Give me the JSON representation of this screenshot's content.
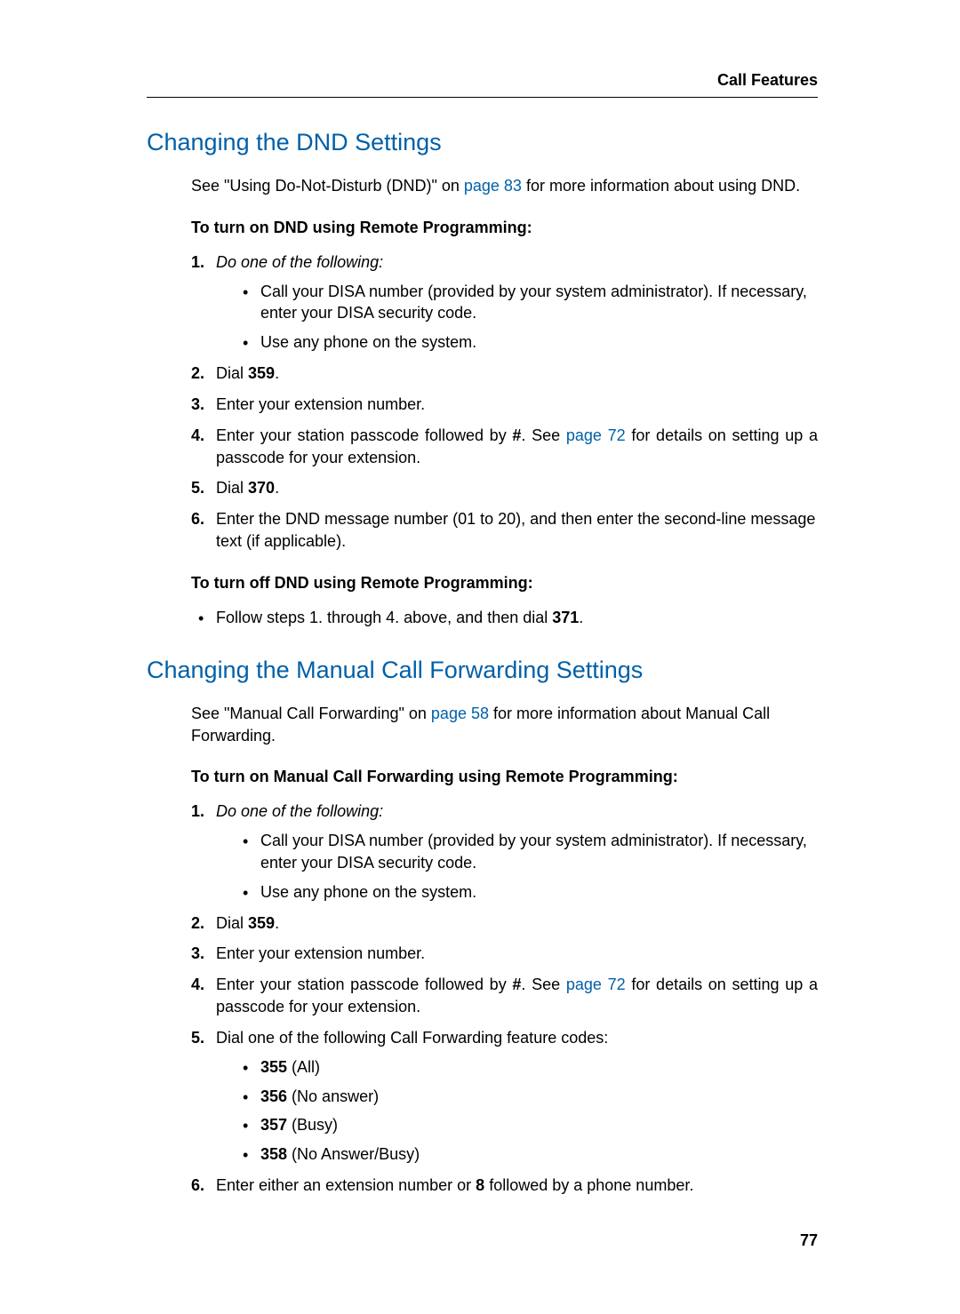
{
  "header": {
    "right": "Call Features"
  },
  "page_number": "77",
  "links": {
    "p83": "page 83",
    "p72": "page 72",
    "p58": "page 58"
  },
  "codes": {
    "c359": "359",
    "c370": "370",
    "c371": "371",
    "c355": "355",
    "c356": "356",
    "c357": "357",
    "c358": "358",
    "eight": "8",
    "hash": "#"
  },
  "sec1": {
    "title": "Changing the DND Settings",
    "intro_a": "See \"Using Do-Not-Disturb (DND)\" on ",
    "intro_b": " for more information about using DND.",
    "sub_on": "To turn on DND using Remote Programming:",
    "step1": "Do one of the following:",
    "step1_a": "Call your DISA number (provided by your system administrator). If necessary, enter your DISA security code.",
    "step1_b": "Use any phone on the system.",
    "step2_a": "Dial ",
    "step2_b": ".",
    "step3": "Enter your extension number.",
    "step4_a": "Enter your station passcode followed by ",
    "step4_b": ". See ",
    "step4_c": " for details on setting up a passcode for your extension.",
    "step5_a": "Dial ",
    "step5_b": ".",
    "step6": "Enter the DND message number (01 to 20), and then enter the second-line message text (if applicable).",
    "sub_off": "To turn off DND using Remote Programming:",
    "off_a": "Follow steps 1. through 4. above, and then dial ",
    "off_b": "."
  },
  "sec2": {
    "title": "Changing the Manual Call Forwarding Settings",
    "intro_a": "See \"Manual Call Forwarding\" on ",
    "intro_b": " for more information about Manual Call Forwarding.",
    "sub_on": "To turn on Manual Call Forwarding using Remote Programming:",
    "step1": "Do one of the following:",
    "step1_a": "Call your DISA number (provided by your system administrator). If necessary, enter your DISA security code.",
    "step1_b": "Use any phone on the system.",
    "step2_a": "Dial ",
    "step2_b": ".",
    "step3": "Enter your extension number.",
    "step4_a": "Enter your station passcode followed by ",
    "step4_b": ". See ",
    "step4_c": " for details on setting up a passcode for your extension.",
    "step5": "Dial one of the following Call Forwarding feature codes:",
    "code_all": " (All)",
    "code_noans": " (No answer)",
    "code_busy": " (Busy)",
    "code_noans_busy": " (No Answer/Busy)",
    "step6_a": "Enter either an extension number or ",
    "step6_b": " followed by a phone number."
  }
}
